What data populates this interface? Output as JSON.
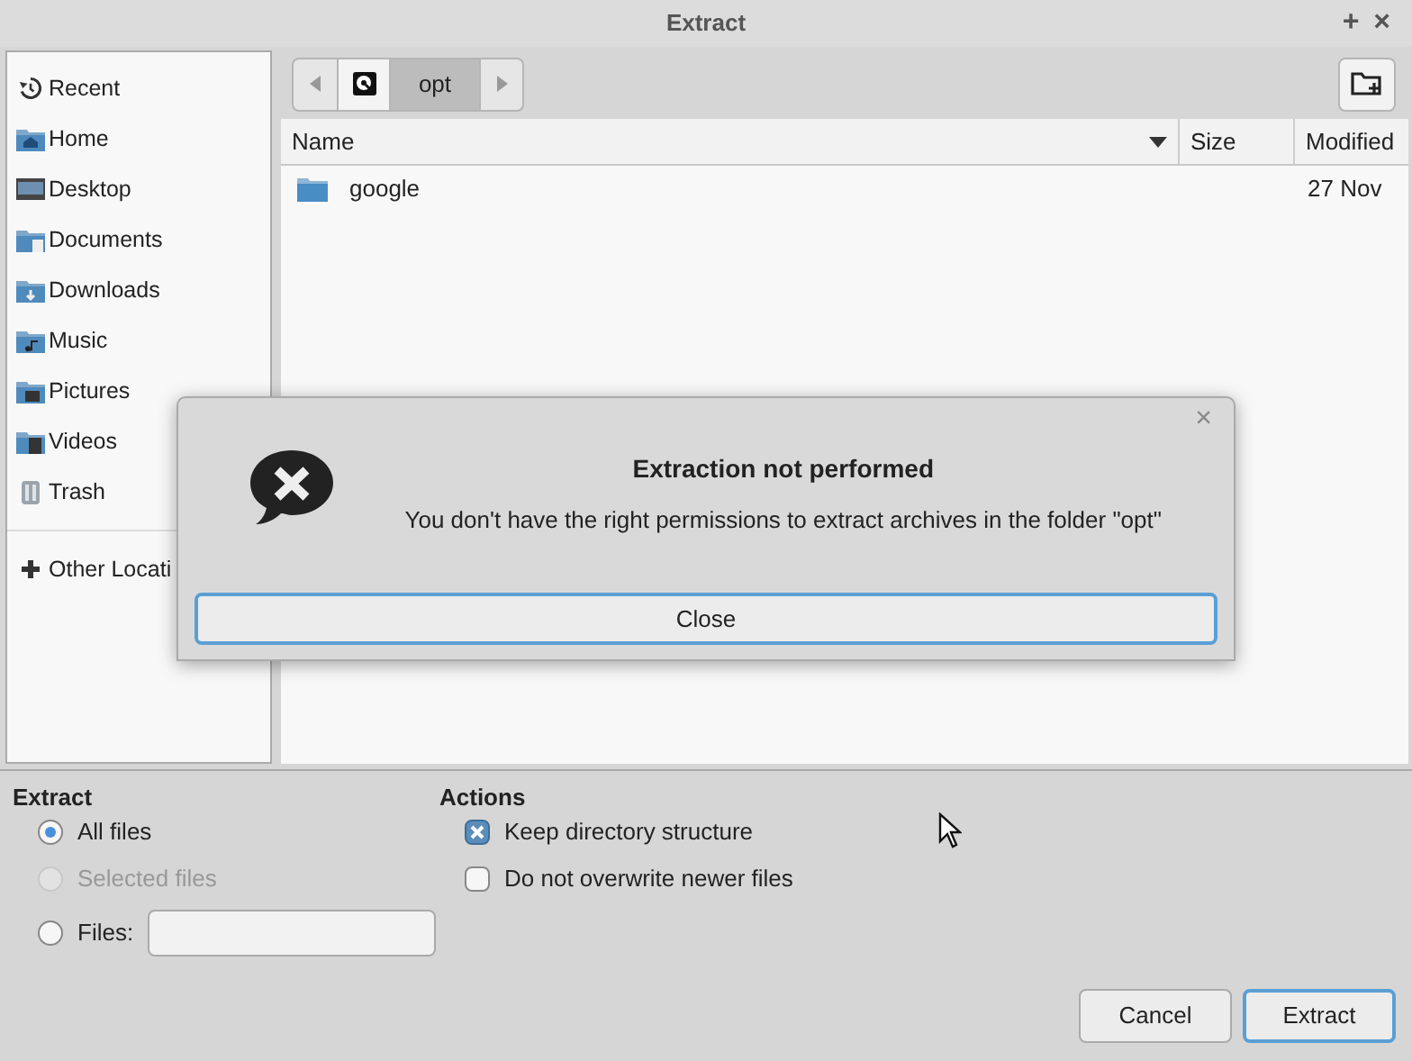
{
  "window": {
    "title": "Extract",
    "buttons": [
      "+",
      "×"
    ]
  },
  "sidebar": {
    "items": [
      {
        "label": "Recent",
        "kind": "recent"
      },
      {
        "label": "Home",
        "kind": "home"
      },
      {
        "label": "Desktop",
        "kind": "desktop"
      },
      {
        "label": "Documents",
        "kind": "documents"
      },
      {
        "label": "Downloads",
        "kind": "downloads"
      },
      {
        "label": "Music",
        "kind": "music"
      },
      {
        "label": "Pictures",
        "kind": "pictures"
      },
      {
        "label": "Videos",
        "kind": "videos"
      },
      {
        "label": "Trash",
        "kind": "trash"
      },
      {
        "label": "Other Locati",
        "kind": "other"
      }
    ]
  },
  "path_bar": {
    "segments": [
      {
        "kind": "drive",
        "selected": false
      },
      {
        "kind": "folder",
        "label": "opt",
        "selected": true
      }
    ]
  },
  "table": {
    "columns": [
      {
        "label": "Name",
        "sorted": true
      },
      {
        "label": "Size",
        "sorted": false
      },
      {
        "label": "Modified",
        "sorted": false
      }
    ],
    "rows": [
      {
        "name": "google",
        "modified": "27 Nov"
      }
    ]
  },
  "extract": {
    "title": "Extract",
    "options": [
      {
        "label": "All files",
        "kind": "plain",
        "selected": true,
        "disabled": false
      },
      {
        "label": "Selected files",
        "kind": "plain",
        "selected": false,
        "disabled": true
      },
      {
        "label": "Files:",
        "kind": "field",
        "selected": false,
        "disabled": false
      }
    ]
  },
  "actions": {
    "title": "Actions",
    "options": [
      {
        "label": "Keep directory structure",
        "checked": true
      },
      {
        "label": "Do not overwrite newer files",
        "checked": false
      }
    ]
  },
  "buttons": [
    {
      "label": "Cancel",
      "focused": false
    },
    {
      "label": "Extract",
      "focused": true
    }
  ],
  "dialog": {
    "close": "×",
    "title": "Extraction not performed",
    "message": "You don't have the right permissions to extract archives in the folder \"opt\"",
    "button": {
      "label": "Close",
      "focused": true
    }
  }
}
